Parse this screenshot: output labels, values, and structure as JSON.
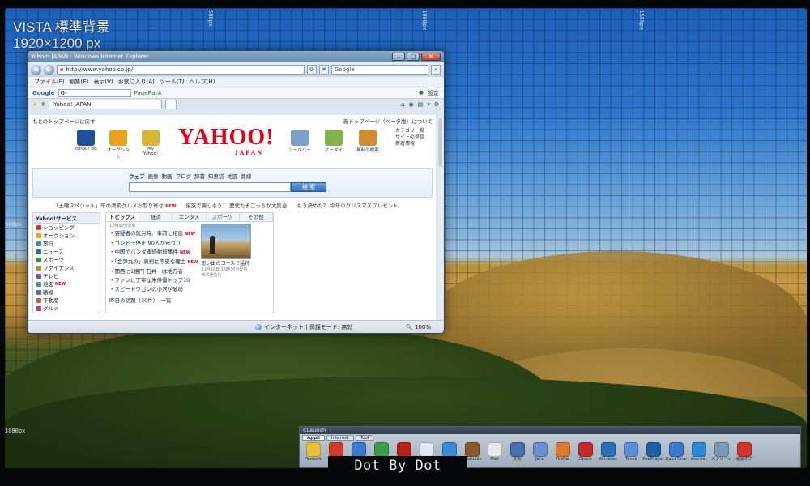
{
  "overlay": {
    "title_line1": "VISTA 標準背景",
    "title_line2": "1920×1200 px",
    "ruler_top_1": "500px",
    "ruler_top_2": "1000px",
    "ruler_top_3": "1500px",
    "ruler_left_1": "500px",
    "ruler_left_2": "1000px"
  },
  "ie": {
    "window_title": "Yahoo! JAPAN - Windows Internet Explorer",
    "address": "http://www.yahoo.co.jp/",
    "search_placeholder": "Google",
    "menu": [
      "ファイル(F)",
      "編集(E)",
      "表示(V)",
      "お気に入り(A)",
      "ツール(T)",
      "ヘルプ(H)"
    ],
    "google_toolbar_label": "Google",
    "google_toolbar_value": "G-",
    "pagerank_label": "PageRank",
    "settings_label": "設定",
    "tab_title": "Yahoo! JAPAN",
    "page": {
      "back_link": "もとのトップページに戻す",
      "new_top_link": "新トップページ（ベータ版）について",
      "services": [
        {
          "label": "Yahoo! BB",
          "color": "#1d4f9c"
        },
        {
          "label": "オークション",
          "color": "#e7a320"
        },
        {
          "label": "My Yahoo!",
          "color": "#d9b53a"
        },
        {
          "label": "ツールバー",
          "color": "#7aa0c8"
        },
        {
          "label": "ケータイ",
          "color": "#82b34a"
        },
        {
          "label": "無料の検索",
          "color": "#d48a32"
        }
      ],
      "logo_text": "YAHOO!",
      "logo_sub": "JAPAN",
      "head_links": [
        "カテゴリ一覧",
        "サイトの登録",
        "新着情報"
      ],
      "search_tabs": [
        "ウェブ",
        "画像",
        "動画",
        "ブログ",
        "辞書",
        "知恵袋",
        "地図",
        "路線"
      ],
      "search_button": "検 索",
      "promos": [
        {
          "text": "「土曜スペシャル」年の清明グルメお取り寄せ",
          "badge": "NEW"
        },
        {
          "text": "家族で楽しもう！ 歴代たまごっちが大集合",
          "badge": ""
        },
        {
          "text": "もう決めた？ 今年のクリスマスプレゼント",
          "badge": ""
        }
      ],
      "sidebar_title": "Yahoo!サービス",
      "sidebar_items": [
        {
          "label": "ショッピング",
          "color": "#d23b3b",
          "badge": ""
        },
        {
          "label": "オークション",
          "color": "#e7a320",
          "badge": ""
        },
        {
          "label": "旅行",
          "color": "#3a8ad0",
          "badge": ""
        },
        {
          "label": "ニュース",
          "color": "#3366aa",
          "badge": ""
        },
        {
          "label": "スポーツ",
          "color": "#2f9a3a",
          "badge": ""
        },
        {
          "label": "ファイナンス",
          "color": "#c0892a",
          "badge": ""
        },
        {
          "label": "テレビ",
          "color": "#6b5bb5",
          "badge": ""
        },
        {
          "label": "地図",
          "color": "#3a9a88",
          "badge": "NEW"
        },
        {
          "label": "路線",
          "color": "#4a6fb0",
          "badge": ""
        },
        {
          "label": "不動産",
          "color": "#b06a3a",
          "badge": ""
        },
        {
          "label": "グルメ",
          "color": "#c23a6a",
          "badge": ""
        }
      ],
      "topic_tabs": [
        "トピックス",
        "経済",
        "エンタメ",
        "スポーツ",
        "その他"
      ],
      "topics_date": "12時30分更新",
      "topics": [
        {
          "text": "・容疑者の就労時、事前に相談",
          "badge": "NEW"
        },
        {
          "text": "・ゴンドラ停止 90人が宙づり",
          "badge": ""
        },
        {
          "text": "・中国でパンダ連続射殺事件",
          "badge": "NEW"
        },
        {
          "text": "・「金弾丸の」真剣に不安な理由",
          "badge": "NEW"
        },
        {
          "text": "・関西に1億円 石井一は地方者",
          "badge": ""
        },
        {
          "text": "・ファンに丁寧な米俳優トップ10",
          "badge": ""
        },
        {
          "text": "・スピードワゴンの小沢が破局",
          "badge": ""
        }
      ],
      "topics_more": "昨日の話題（30件）　一覧",
      "photo_caption": "思い出のコースで猛特",
      "photo_sub_1": "11月18日 15時30分配信",
      "photo_sub_2": "時事通信社"
    },
    "status_zone": "インターネット | 保護モード: 無効",
    "zoom": "100%"
  },
  "clauncher": {
    "title": "CLaunch",
    "tabs": [
      "Appli",
      "Internet",
      "Tool"
    ],
    "icons": [
      {
        "label": "Firework",
        "color": "#e9c23a"
      },
      {
        "label": "Opera",
        "color": "#d23b2b"
      },
      {
        "label": "IE",
        "color": "#3a7ad0"
      },
      {
        "label": "Chrome",
        "color": "#3aa04a"
      },
      {
        "label": "Acrobat",
        "color": "#b8201a"
      },
      {
        "label": "Edit",
        "color": "#e0e6ee"
      },
      {
        "label": "Safari",
        "color": "#3a8ad8"
      },
      {
        "label": "Shortcuts",
        "color": "#8a5a2a"
      },
      {
        "label": "Mail",
        "color": "#e8e8e8"
      },
      {
        "label": "天気",
        "color": "#4a6fb0"
      },
      {
        "label": "Juno",
        "color": "#6a8fd0"
      },
      {
        "label": "Firefox",
        "color": "#e07a2a"
      },
      {
        "label": "Opera",
        "color": "#c22b2b"
      },
      {
        "label": "Windows",
        "color": "#2a6fb8"
      },
      {
        "label": "iTunes",
        "color": "#5a8fd8"
      },
      {
        "label": "RealPlayer",
        "color": "#1f5fa8"
      },
      {
        "label": "QuickTime",
        "color": "#3a7ad0"
      },
      {
        "label": "Internet",
        "color": "#2a8ad8"
      },
      {
        "label": "スクリーン",
        "color": "#7a9ab8"
      },
      {
        "label": "電源オプ",
        "color": "#d0352a"
      }
    ]
  },
  "bottom_label": "Dot By Dot"
}
